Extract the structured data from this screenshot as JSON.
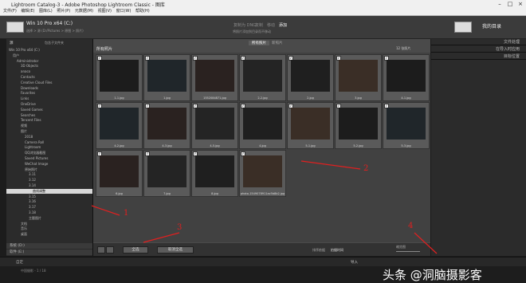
{
  "window": {
    "title": "Lightroom Catalog-3 - Adobe Photoshop Lightroom Classic - 图库"
  },
  "menu": [
    "文件(F)",
    "编辑(E)",
    "图库(L)",
    "照片(P)",
    "元数据(M)",
    "视图(V)",
    "窗口(W)",
    "帮助(H)"
  ],
  "import_header": {
    "source_label": "Win 10 Pro x64 (C:)",
    "source_sub": "选择 > 源 (D:/Pictures > 原图 > 照片)",
    "modes": [
      "复制为 DNG",
      "复制",
      "移动",
      "添加"
    ],
    "mode_selected": "添加",
    "mode_sub": "将照片添加到目录而不移动",
    "dest_label": "我的目录"
  },
  "left_panel": {
    "header": "源",
    "include_subfolders": "包含子文件夹",
    "tree": [
      "Win 10 Pro x64 (C:)",
      "用户",
      "Administrator",
      "3D Objects",
      "anaco",
      "Contacts",
      "Creative Cloud Files",
      "Downloads",
      "Favorites",
      "Links",
      "OneDrive",
      "Saved Games",
      "Searches",
      "Tencent Files",
      "视频",
      "图片",
      "2018",
      "Camera Roll",
      "Lightroom",
      "QQ浏览器截图",
      "Saved Pictures",
      "WeChat Image",
      "原始照片",
      "3.11",
      "3.12",
      "3.14",
      "曲线调整",
      "3.15",
      "3.16",
      "3.17",
      "3.18",
      "主题图片",
      "文档",
      "音乐",
      "桌面"
    ],
    "selected": "曲线调整",
    "footer_items": [
      "系统 (D:)",
      "软件 (E:)"
    ]
  },
  "center": {
    "tabs": [
      "所有照片",
      "新照片"
    ],
    "tab_selected": "所有照片",
    "grid_title": "所有照片",
    "sort_label": "12 张照片",
    "thumbnails": [
      "1-1.jpg",
      "1.jpg",
      "1552084871.jpg",
      "2-2.jpg",
      "2.jpg",
      "3.jpg",
      "4-1.jpg",
      "4-2.jpg",
      "4-3.jpg",
      "4-5.jpg",
      "4.jpg",
      "5-1.jpg",
      "5-2.jpg",
      "5-3.jpg",
      "6.jpg",
      "7.jpg",
      "8.jpg",
      "photo-1549078911ac5b8b2.jpg"
    ],
    "toolbar": {
      "check_all": "全选",
      "uncheck_all": "取消全选",
      "sort_label": "排序依据",
      "sort_value": "拍摄时间",
      "thumb_label": "缩览图"
    }
  },
  "right_panel": {
    "sections": [
      "文件处理",
      "在导入时应用",
      "目标位置"
    ]
  },
  "bottom_bar": {
    "left": "自定",
    "right": "导入"
  },
  "status_bar": {
    "text": "中国摄影 - 1 / 18"
  },
  "annotations": [
    "1",
    "2",
    "3",
    "4"
  ],
  "watermark": "头条 @洞脑摄影客",
  "colors": {
    "annotation": "#e02020",
    "accent": "#d6d6d6"
  }
}
